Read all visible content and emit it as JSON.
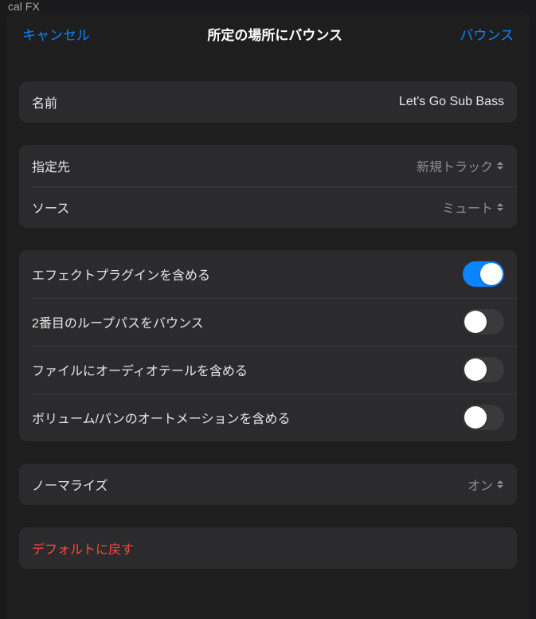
{
  "background": {
    "partial_text": "cal FX"
  },
  "header": {
    "cancel": "キャンセル",
    "title": "所定の場所にバウンス",
    "confirm": "バウンス"
  },
  "name_section": {
    "label": "名前",
    "value": "Let's Go Sub Bass"
  },
  "destination_section": {
    "destination_label": "指定先",
    "destination_value": "新規トラック",
    "source_label": "ソース",
    "source_value": "ミュート"
  },
  "options_section": {
    "include_effects": {
      "label": "エフェクトプラグインを含める",
      "on": true
    },
    "bounce_second_loop": {
      "label": "2番目のループパスをバウンス",
      "on": false
    },
    "include_audio_tail": {
      "label": "ファイルにオーディオテールを含める",
      "on": false
    },
    "include_vol_pan_automation": {
      "label": "ボリューム/パンのオートメーションを含める",
      "on": false
    }
  },
  "normalize_section": {
    "label": "ノーマライズ",
    "value": "オン"
  },
  "reset_section": {
    "label": "デフォルトに戻す"
  }
}
